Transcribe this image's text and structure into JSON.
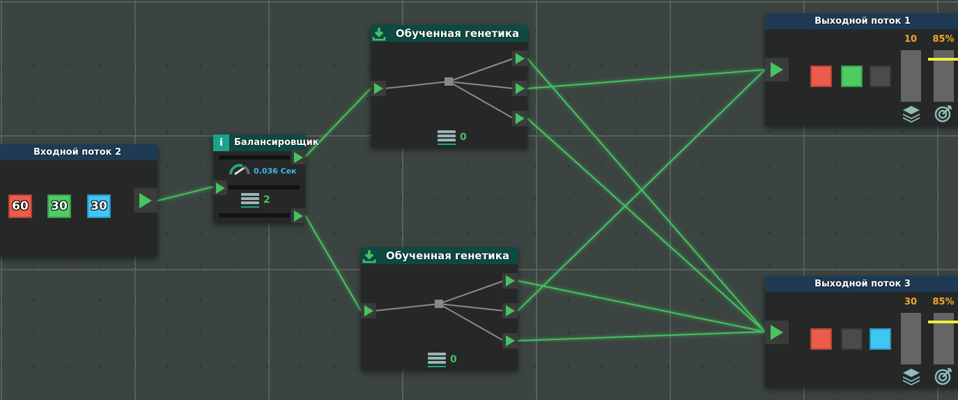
{
  "input_node": {
    "title": "Входной поток 2",
    "chips": [
      {
        "value": "60",
        "color": "#ec5b4b"
      },
      {
        "value": "30",
        "color": "#4ccc63"
      },
      {
        "value": "30",
        "color": "#3ec6f4"
      }
    ]
  },
  "balancer": {
    "title": "Балансировщик",
    "info_icon": "i",
    "speed": "0.036 Сек",
    "count": "2"
  },
  "genetics": [
    {
      "title": "Обученная генетика",
      "count": "0"
    },
    {
      "title": "Обученная генетика",
      "count": "0"
    }
  ],
  "outputs": [
    {
      "title": "Выходной поток 1",
      "count": "10",
      "percent": "85%",
      "threshold": 0.85,
      "slots": [
        "#ec5b4b",
        "#4ccc63",
        "#4a4b4b"
      ]
    },
    {
      "title": "Выходной поток 3",
      "count": "30",
      "percent": "85%",
      "threshold": 0.85,
      "slots": [
        "#ec5b4b",
        "#4a4b4b",
        "#3ec6f4"
      ]
    }
  ],
  "colors": {
    "wire": "#45c45f",
    "port": "#45c45f",
    "header_blue": "#1f3a55",
    "header_teal": "#0d4a43",
    "threshold": "#f0f03a"
  }
}
